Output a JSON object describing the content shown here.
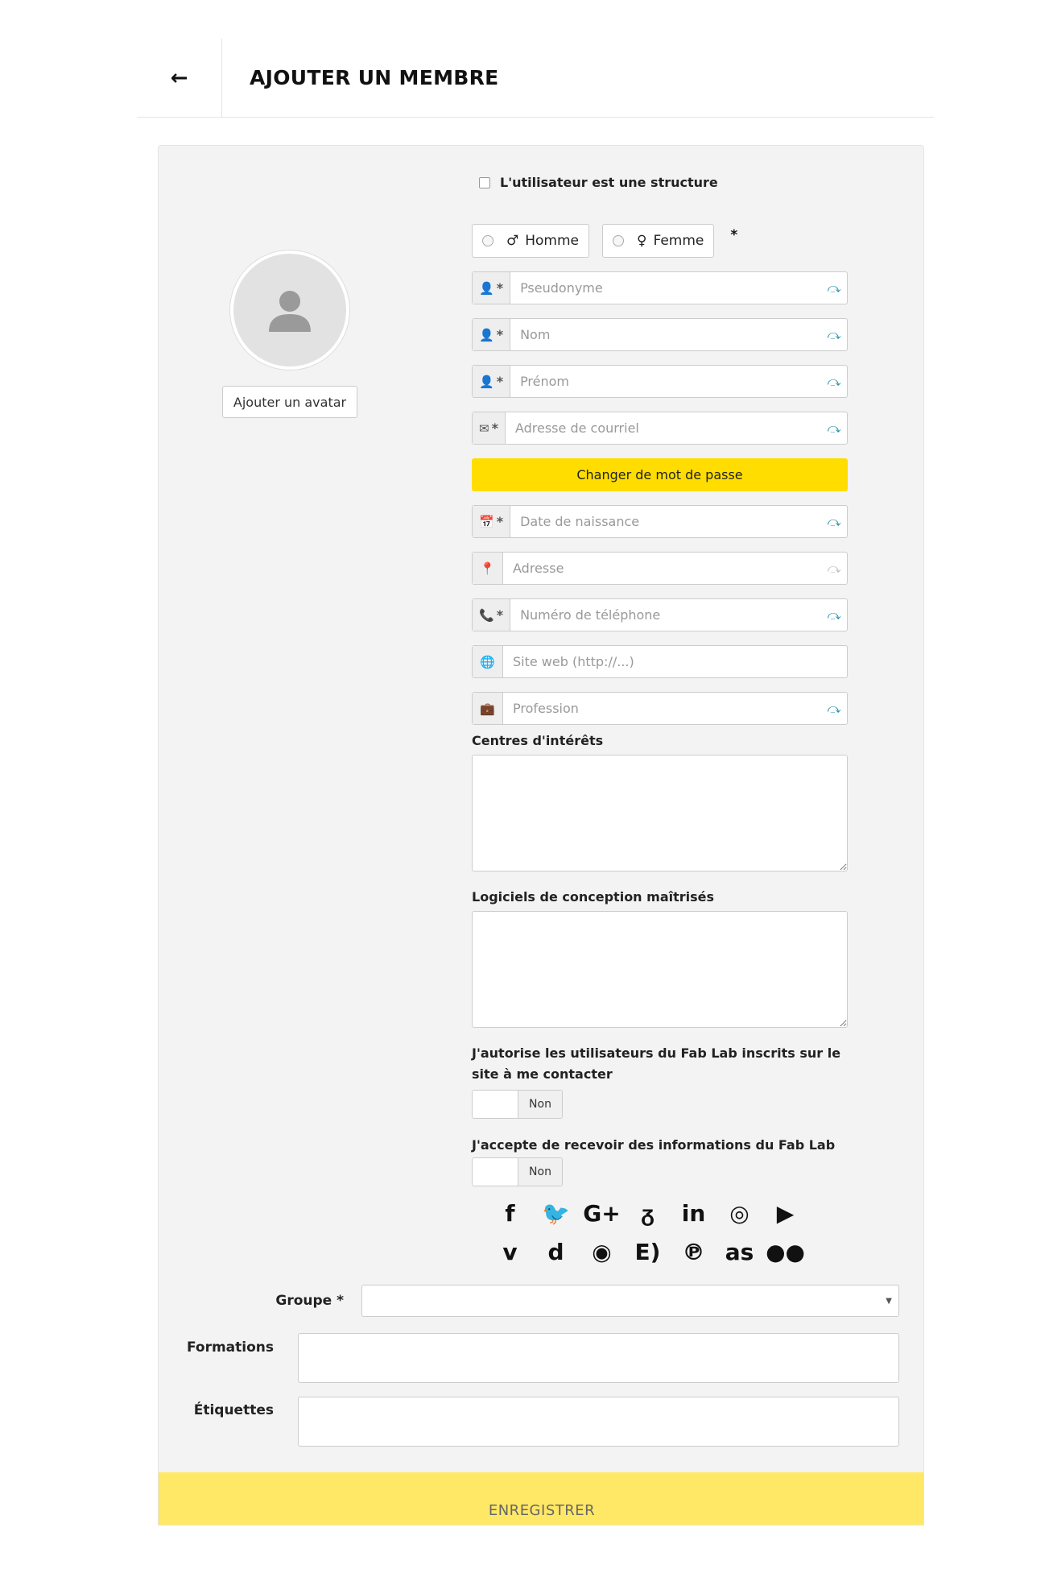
{
  "header": {
    "back": "←",
    "title": "AJOUTER UN MEMBRE"
  },
  "avatar": {
    "button": "Ajouter un avatar"
  },
  "structure_checkbox": "L'utilisateur est une structure",
  "gender": {
    "male": "Homme",
    "female": "Femme",
    "required": "*"
  },
  "fields": {
    "pseudonyme": "Pseudonyme",
    "nom": "Nom",
    "prenom": "Prénom",
    "email": "Adresse de courriel",
    "birth": "Date de naissance",
    "address": "Adresse",
    "phone": "Numéro de téléphone",
    "website": "Site web (http://...)",
    "profession": "Profession"
  },
  "required_mark": "*",
  "change_password": "Changer de mot de passe",
  "interests_label": "Centres d'intérêts",
  "software_label": "Logiciels de conception maîtrisés",
  "contact_label": "J'autorise les utilisateurs du Fab Lab inscrits sur le site à me contacter",
  "contact_state": "Non",
  "news_label": "J'accepte de recevoir des informations du Fab Lab",
  "news_state": "Non",
  "socials": [
    {
      "name": "facebook-icon",
      "glyph": "f"
    },
    {
      "name": "twitter-icon",
      "glyph": "🐦"
    },
    {
      "name": "google-plus-icon",
      "glyph": "G+"
    },
    {
      "name": "viadeo-icon",
      "glyph": "ᵹ"
    },
    {
      "name": "linkedin-icon",
      "glyph": "in"
    },
    {
      "name": "instagram-icon",
      "glyph": "◎"
    },
    {
      "name": "youtube-icon",
      "glyph": "▶"
    },
    {
      "name": "vimeo-icon",
      "glyph": "v"
    },
    {
      "name": "dailymotion-icon",
      "glyph": "d"
    },
    {
      "name": "github-icon",
      "glyph": "◉"
    },
    {
      "name": "echosciences-icon",
      "glyph": "E)"
    },
    {
      "name": "pinterest-icon",
      "glyph": "℗"
    },
    {
      "name": "lastfm-icon",
      "glyph": "as"
    },
    {
      "name": "flickr-icon",
      "glyph": "●●"
    }
  ],
  "group": {
    "label": "Groupe",
    "required": "*"
  },
  "formations_label": "Formations",
  "tags_label": "Étiquettes",
  "save": "ENREGISTRER",
  "colors": {
    "accent": "#ffdd00",
    "save_bar": "#ffe866",
    "panel": "#f3f3f3",
    "valid_icon": "#1f8fa7"
  }
}
